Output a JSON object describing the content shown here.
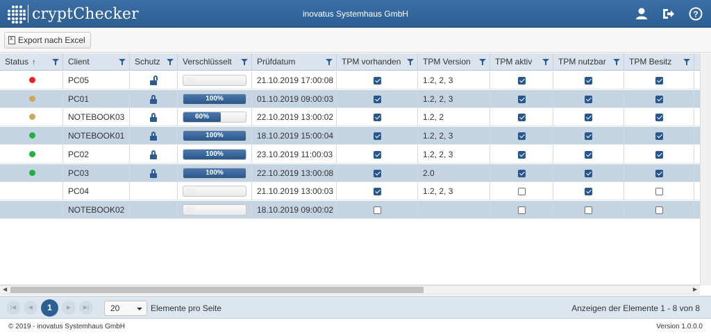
{
  "app": {
    "logo_text": "cryptChecker",
    "company": "inovatus Systemhaus GmbH"
  },
  "header_icons": [
    "user-icon",
    "logout-icon",
    "help-icon"
  ],
  "toolbar": {
    "export_label": "Export nach Excel"
  },
  "columns": [
    {
      "key": "status",
      "label": "Status",
      "sorted": "asc"
    },
    {
      "key": "client",
      "label": "Client"
    },
    {
      "key": "schutz",
      "label": "Schutz"
    },
    {
      "key": "verschluesselt",
      "label": "Verschlüsselt"
    },
    {
      "key": "pruefdatum",
      "label": "Prüfdatum"
    },
    {
      "key": "tpm_vorhanden",
      "label": "TPM vorhanden"
    },
    {
      "key": "tpm_version",
      "label": "TPM Version"
    },
    {
      "key": "tpm_aktiv",
      "label": "TPM aktiv"
    },
    {
      "key": "tpm_nutzbar",
      "label": "TPM nutzbar"
    },
    {
      "key": "tpm_besitz",
      "label": "TPM Besitz"
    }
  ],
  "colors": {
    "red": "#f02020",
    "gold": "#c9a95a",
    "green": "#1fb040",
    "accent": "#2e5f93"
  },
  "rows": [
    {
      "status": "red",
      "client": "PC05",
      "schutz": "unlocked",
      "encrypted_pct": 0,
      "encrypted_label": "0%",
      "pruefdatum": "21.10.2019 17:00:08",
      "tpm_vorhanden": true,
      "tpm_version": "1.2, 2, 3",
      "tpm_aktiv": true,
      "tpm_nutzbar": true,
      "tpm_besitz": true
    },
    {
      "status": "gold",
      "client": "PC01",
      "schutz": "locked",
      "encrypted_pct": 100,
      "encrypted_label": "100%",
      "pruefdatum": "01.10.2019 09:00:03",
      "tpm_vorhanden": true,
      "tpm_version": "1.2, 2, 3",
      "tpm_aktiv": true,
      "tpm_nutzbar": true,
      "tpm_besitz": true
    },
    {
      "status": "gold",
      "client": "NOTEBOOK03",
      "schutz": "locked",
      "encrypted_pct": 60,
      "encrypted_label": "60%",
      "pruefdatum": "22.10.2019 13:00:02",
      "tpm_vorhanden": true,
      "tpm_version": "1.2, 2",
      "tpm_aktiv": true,
      "tpm_nutzbar": true,
      "tpm_besitz": true
    },
    {
      "status": "green",
      "client": "NOTEBOOK01",
      "schutz": "locked",
      "encrypted_pct": 100,
      "encrypted_label": "100%",
      "pruefdatum": "18.10.2019 15:00:04",
      "tpm_vorhanden": true,
      "tpm_version": "1.2, 2, 3",
      "tpm_aktiv": true,
      "tpm_nutzbar": true,
      "tpm_besitz": true
    },
    {
      "status": "green",
      "client": "PC02",
      "schutz": "locked",
      "encrypted_pct": 100,
      "encrypted_label": "100%",
      "pruefdatum": "23.10.2019 11:00:03",
      "tpm_vorhanden": true,
      "tpm_version": "1.2, 2, 3",
      "tpm_aktiv": true,
      "tpm_nutzbar": true,
      "tpm_besitz": true
    },
    {
      "status": "green",
      "client": "PC03",
      "schutz": "locked",
      "encrypted_pct": 100,
      "encrypted_label": "100%",
      "pruefdatum": "22.10.2019 13:00:08",
      "tpm_vorhanden": true,
      "tpm_version": "2.0",
      "tpm_aktiv": true,
      "tpm_nutzbar": true,
      "tpm_besitz": true
    },
    {
      "status": "",
      "client": "PC04",
      "schutz": "",
      "encrypted_pct": 0,
      "encrypted_label": "0%",
      "pruefdatum": "21.10.2019 13:00:03",
      "tpm_vorhanden": true,
      "tpm_version": "1.2, 2, 3",
      "tpm_aktiv": false,
      "tpm_nutzbar": true,
      "tpm_besitz": false
    },
    {
      "status": "",
      "client": "NOTEBOOK02",
      "schutz": "",
      "encrypted_pct": 0,
      "encrypted_label": "0%",
      "pruefdatum": "18.10.2019 09:00:02",
      "tpm_vorhanden": false,
      "tpm_version": "",
      "tpm_aktiv": false,
      "tpm_nutzbar": false,
      "tpm_besitz": false
    }
  ],
  "pager": {
    "current_page": "1",
    "page_size": "20",
    "page_size_label": "Elemente pro Seite",
    "info": "Anzeigen der Elemente 1 - 8 von 8"
  },
  "footer": {
    "copyright": "© 2019 - inovatus Systemhaus GmbH",
    "version": "Version 1.0.0.0"
  }
}
